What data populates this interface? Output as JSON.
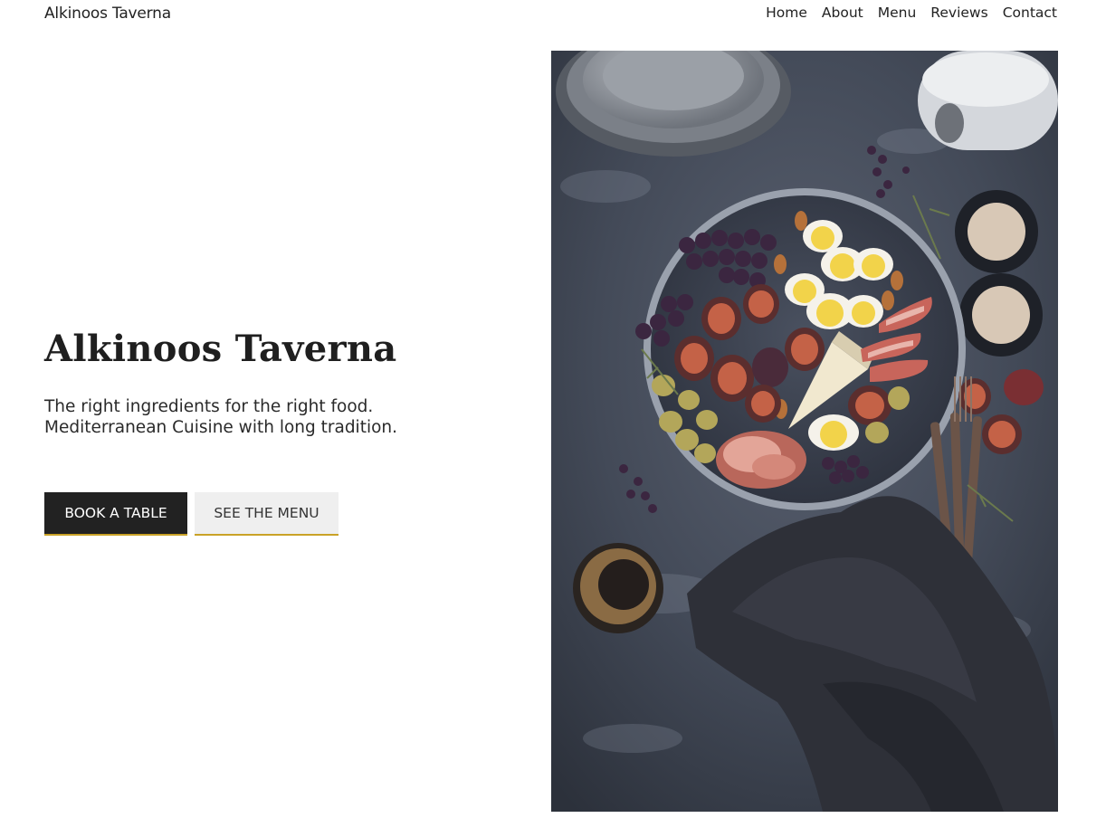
{
  "header": {
    "brand": "Alkinoos Taverna",
    "nav": [
      "Home",
      "About",
      "Menu",
      "Reviews",
      "Contact"
    ]
  },
  "hero": {
    "title": "Alkinoos Taverna",
    "subtitle_lines": [
      "The right ingredients for the right food.",
      "Mediterranean Cuisine with long tradition."
    ],
    "primary_button": "BOOK A TABLE",
    "secondary_button": "SEE THE MENU",
    "image_subject": "food-platter-photo"
  },
  "colors": {
    "accent_underline": "#c9a227",
    "dark_button": "#222222",
    "light_button": "#efefef"
  }
}
